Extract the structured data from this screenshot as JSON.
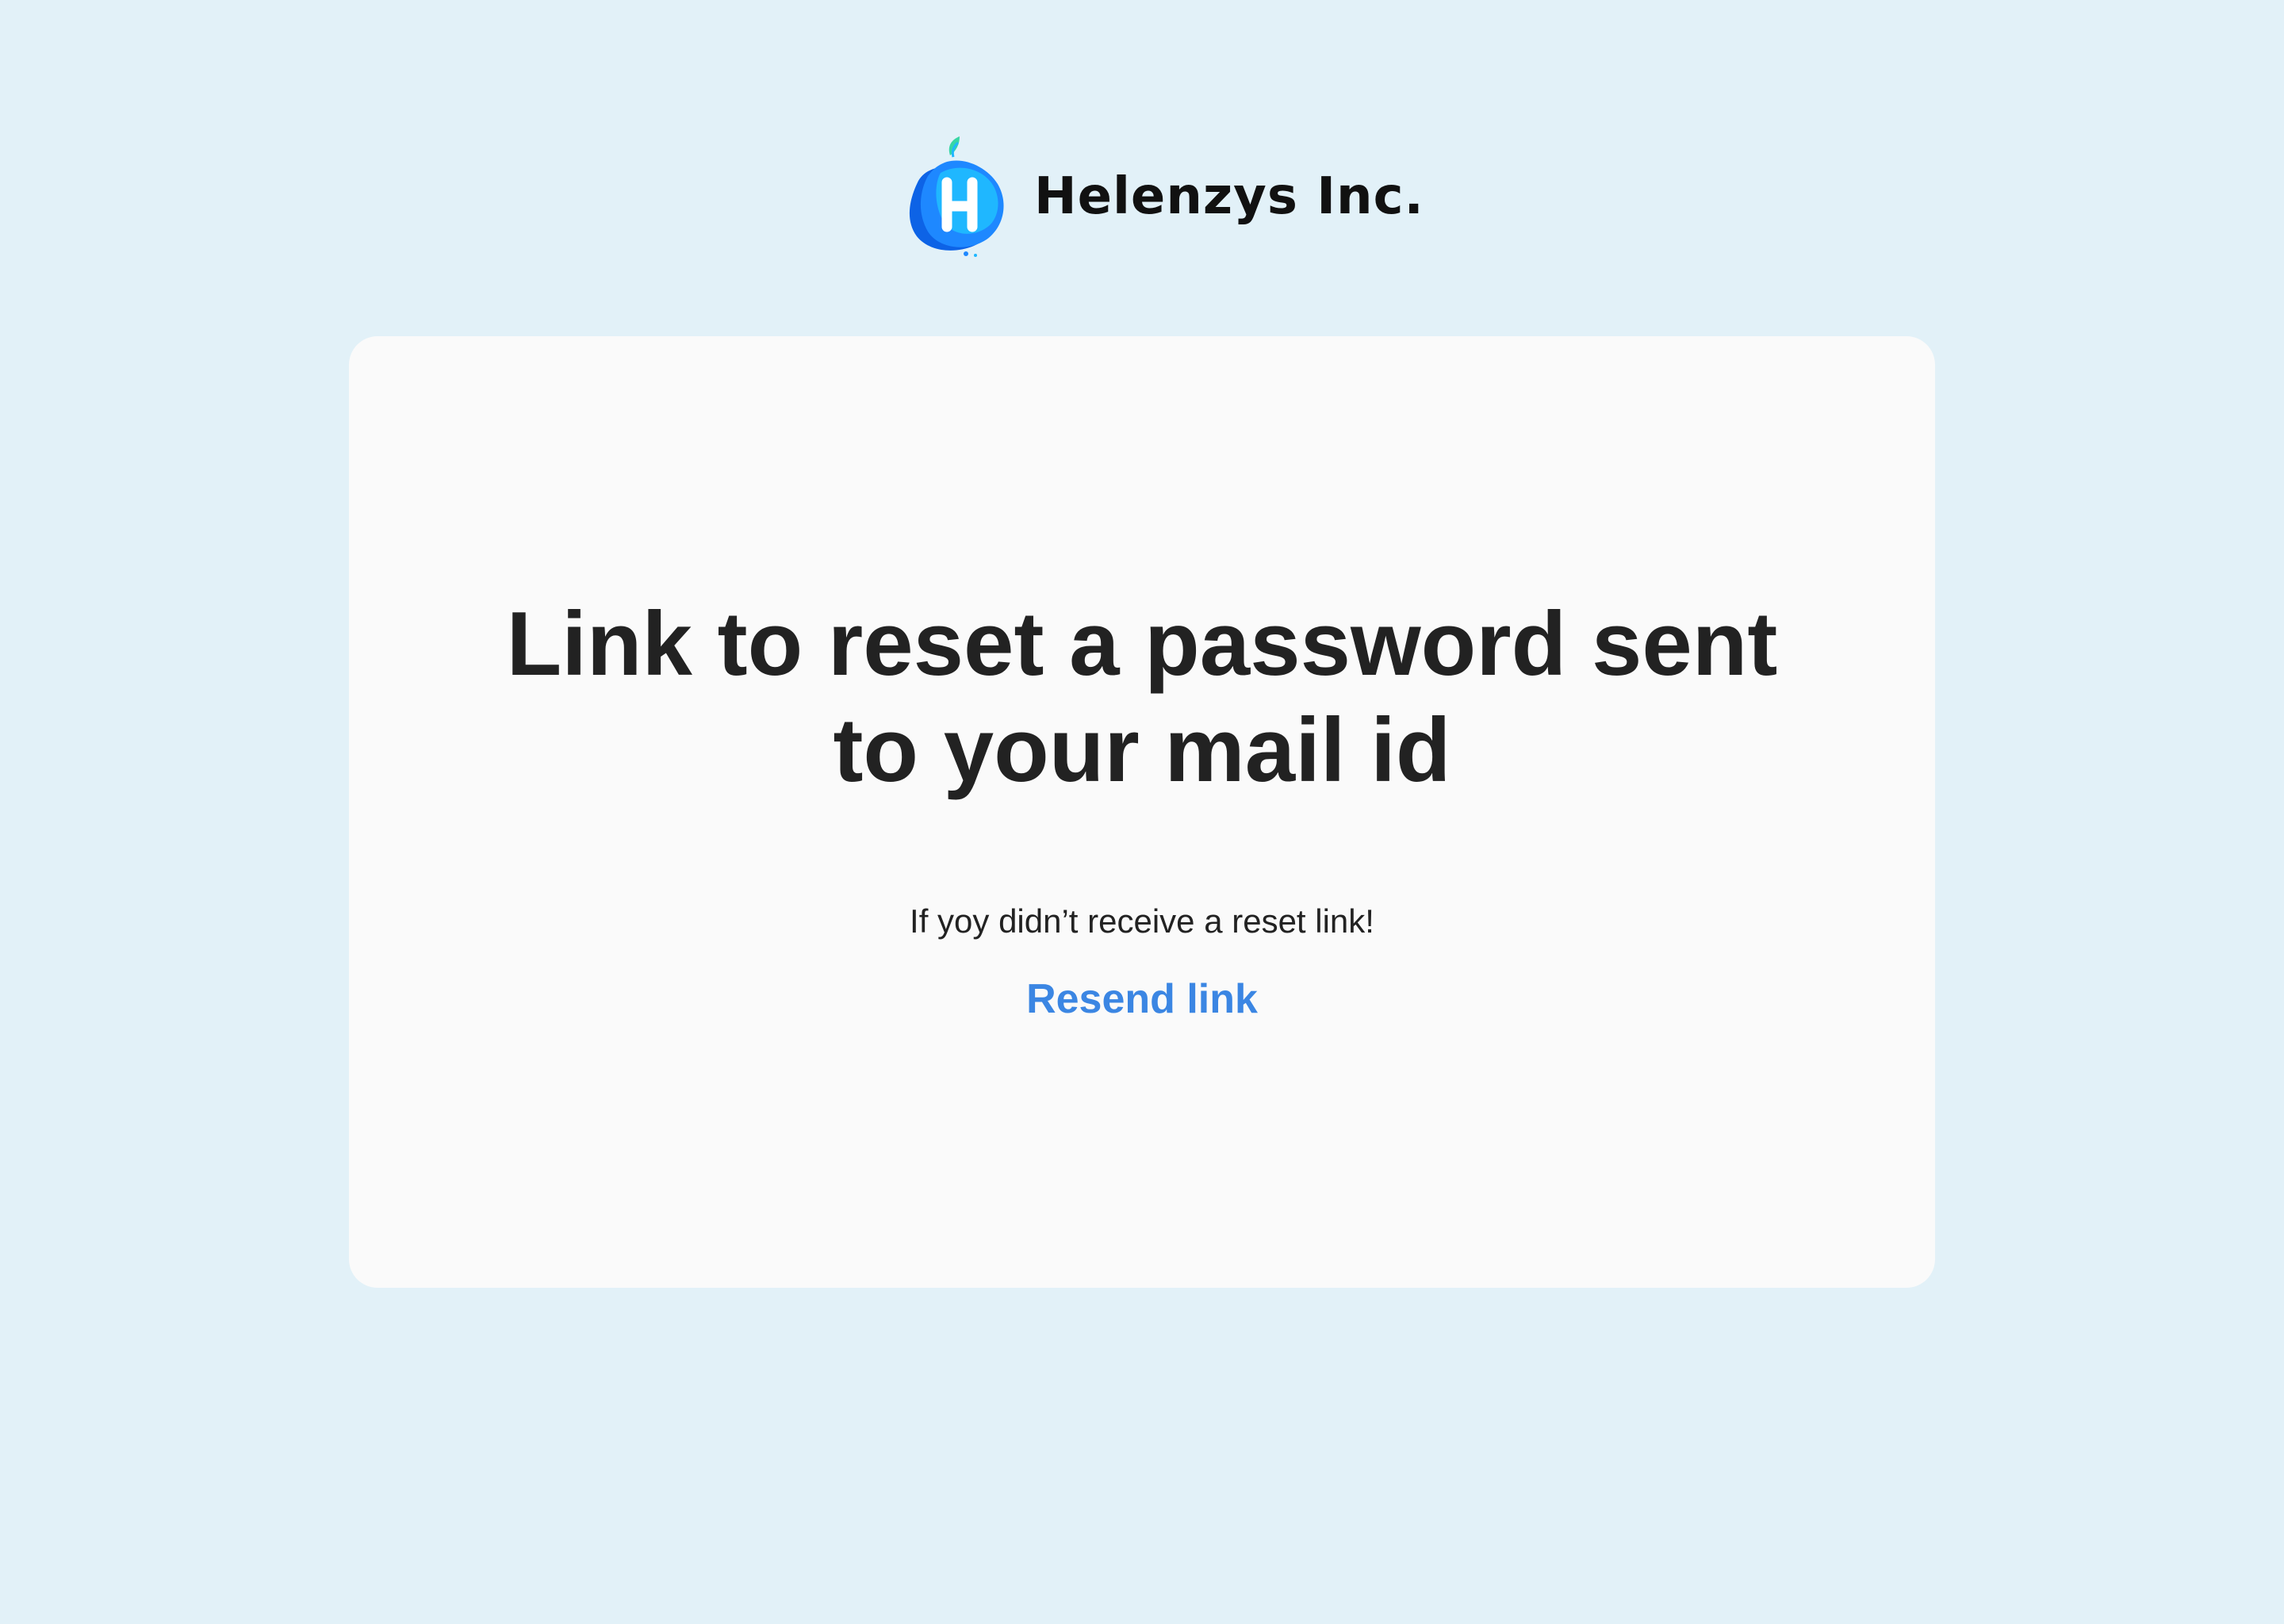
{
  "brand": {
    "name": "Helenzys Inc.",
    "logo_icon": "helenzys-h-blob-logo",
    "logo_colors": [
      "#1e88ff",
      "#1fb7ff",
      "#0d63e6",
      "#37d6a4"
    ]
  },
  "card": {
    "title_lines": [
      "Link to reset a password sent",
      "to your mail id"
    ],
    "hint": "If yoy didn’t receive a reset link!",
    "resend_label": "Resend link"
  },
  "colors": {
    "background": "#e2f1f8",
    "card": "#fafafa",
    "text": "#222222",
    "link": "#3b86e3"
  }
}
